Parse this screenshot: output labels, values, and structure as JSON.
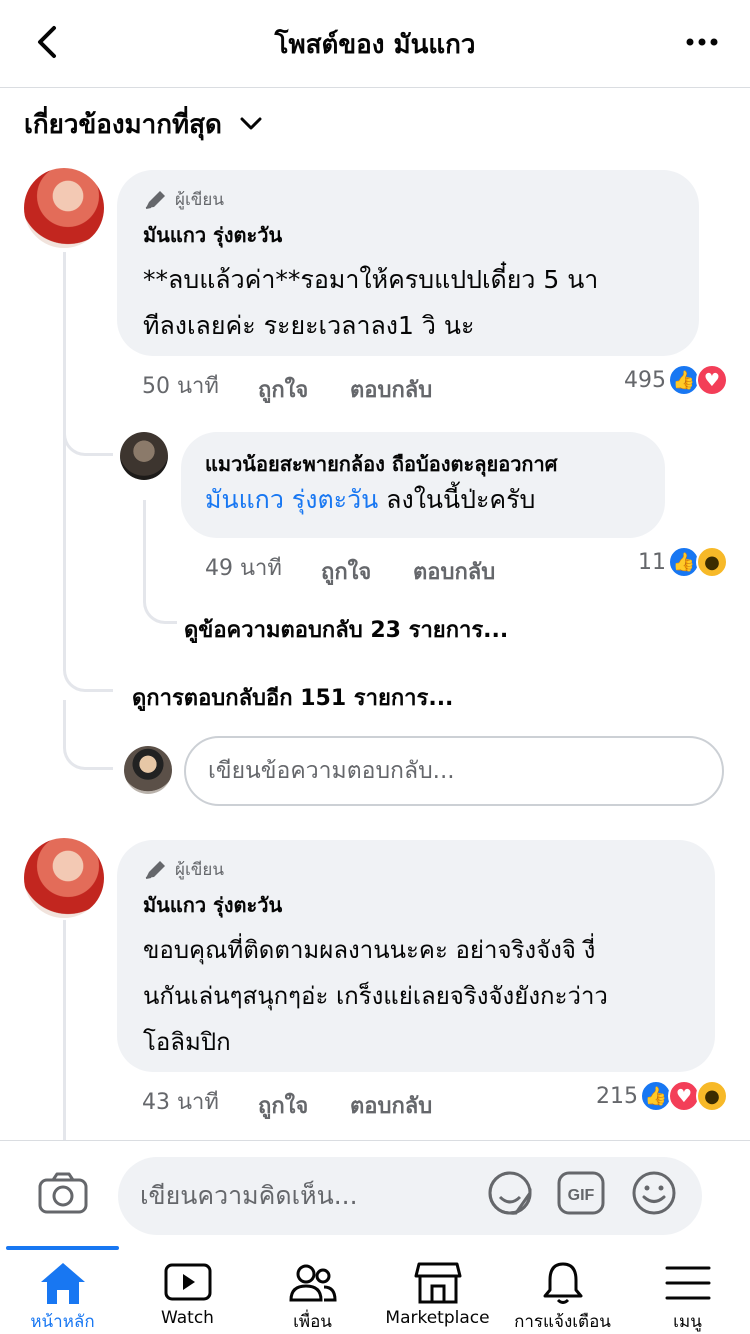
{
  "header": {
    "title": "โพสต์ของ มันแกว"
  },
  "sort": {
    "label": "เกี่ยวข้องมากที่สุด"
  },
  "comments": [
    {
      "author_tag": "ผู้เขียน",
      "name": "มันแกว รุ่งตะวัน",
      "text_line1": "**ลบแล้วค่า**รอมาให้ครบแปปเดี๋ยว 5 นา",
      "text_line2": "ทีลงเลยค่ะ ระยะเวลาลง1 วิ นะ",
      "time": "50 นาที",
      "like": "ถูกใจ",
      "reply": "ตอบกลับ",
      "reaction_count": "495"
    },
    {
      "author_tag": "ผู้เขียน",
      "name": "มันแกว รุ่งตะวัน",
      "text_line1": "ขอบคุณที่ติดตามผลงานนะคะ อย่าจริงจังจิ งี่",
      "text_line2": "นกันเล่นๆสนุกๆอ่ะ เกร็งแย่เลยจริงจังยังกะว่าว",
      "text_line3": "โอลิมปิก",
      "time": "43 นาที",
      "like": "ถูกใจ",
      "reply": "ตอบกลับ",
      "reaction_count": "215"
    }
  ],
  "reply": {
    "name": "แมวน้อยสะพายกล้อง ถือบ้องตะลุยอวกาศ",
    "mention": "มันแกว รุ่งตะวัน",
    "text": " ลงในนี้ป่ะครับ",
    "time": "49 นาที",
    "like": "ถูกใจ",
    "reply": "ตอบกลับ",
    "reaction_count": "11",
    "view_replies": "ดูข้อความตอบกลับ 23 รายการ..."
  },
  "view_more": "ดูการตอบกลับอีก 151 รายการ...",
  "reply_input": {
    "placeholder": "เขียนข้อความตอบกลับ..."
  },
  "composer": {
    "placeholder": "เขียนความคิดเห็น..."
  },
  "tabs": [
    {
      "label": "หน้าหลัก",
      "icon": "home-icon",
      "active": true
    },
    {
      "label": "Watch",
      "icon": "watch-icon"
    },
    {
      "label": "เพื่อน",
      "icon": "friends-icon"
    },
    {
      "label": "Marketplace",
      "icon": "marketplace-icon"
    },
    {
      "label": "การแจ้งเตือน",
      "icon": "bell-icon"
    },
    {
      "label": "เมนู",
      "icon": "menu-icon"
    }
  ],
  "colors": {
    "accent": "#1877f2",
    "bubble": "#f0f2f5",
    "secondary_text": "#65676b"
  }
}
